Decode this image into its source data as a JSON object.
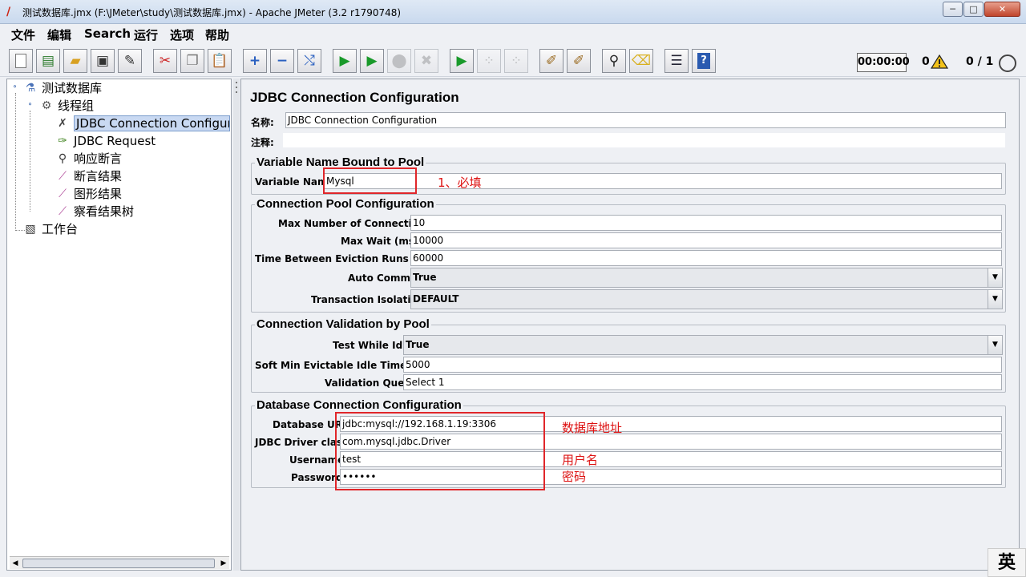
{
  "window": {
    "title": "测试数据库.jmx (F:\\JMeter\\study\\测试数据库.jmx) - Apache JMeter (3.2 r1790748)",
    "minimize": "─",
    "maximize": "□",
    "close": "✕"
  },
  "menu": [
    "文件",
    "编辑",
    "Search",
    "运行",
    "选项",
    "帮助"
  ],
  "toolbar": {
    "timer": "00:00:00",
    "error_count": "0",
    "thread_status": "0 / 1",
    "icons": [
      "new-icon",
      "templates-icon",
      "open-icon",
      "save-icon",
      "save-as-icon",
      "cut-icon",
      "copy-icon",
      "paste-icon",
      "expand-icon",
      "collapse-icon",
      "toggle-icon",
      "start-icon",
      "start-no-pause-icon",
      "stop-icon",
      "shutdown-icon",
      "remote-start-icon",
      "remote-stop-icon",
      "remote-shutdown-icon",
      "clear-icon",
      "clear-all-icon",
      "search-icon",
      "reset-search-icon",
      "function-helper-icon",
      "help-icon"
    ]
  },
  "tree": {
    "items": [
      {
        "label": "测试数据库",
        "icon": "test-plan-icon"
      },
      {
        "label": "线程组",
        "icon": "thread-group-icon"
      },
      {
        "label": "JDBC Connection Configuratio",
        "icon": "config-tool-icon"
      },
      {
        "label": "JDBC Request",
        "icon": "sampler-icon"
      },
      {
        "label": "响应断言",
        "icon": "assertion-icon"
      },
      {
        "label": "断言结果",
        "icon": "listener-icon"
      },
      {
        "label": "图形结果",
        "icon": "listener-icon"
      },
      {
        "label": "察看结果树",
        "icon": "listener-icon"
      },
      {
        "label": "工作台",
        "icon": "workbench-icon"
      }
    ]
  },
  "form": {
    "title": "JDBC Connection Configuration",
    "name_label": "名称:",
    "name_value": "JDBC Connection Configuration",
    "comment_label": "注释:",
    "comment_value": "",
    "pool_var": {
      "title": "Variable Name Bound to Pool",
      "label": "Variable Name:",
      "value": "Mysql"
    },
    "pool_config": {
      "title": "Connection Pool Configuration",
      "max_conn_label": "Max Number of Connections:",
      "max_conn_value": "10",
      "max_wait_label": "Max Wait (ms):",
      "max_wait_value": "10000",
      "eviction_label": "Time Between Eviction Runs (ms):",
      "eviction_value": "60000",
      "auto_commit_label": "Auto Commit:",
      "auto_commit_value": "True",
      "isolation_label": "Transaction Isolation:",
      "isolation_value": "DEFAULT"
    },
    "validation": {
      "title": "Connection Validation by Pool",
      "test_idle_label": "Test While Idle:",
      "test_idle_value": "True",
      "soft_min_label": "Soft Min Evictable Idle Time(ms):",
      "soft_min_value": "5000",
      "query_label": "Validation Query:",
      "query_value": "Select 1"
    },
    "db": {
      "title": "Database Connection Configuration",
      "url_label": "Database URL:",
      "url_value": "jdbc:mysql://192.168.1.19:3306",
      "driver_label": "JDBC Driver class:",
      "driver_value": "com.mysql.jdbc.Driver",
      "user_label": "Username:",
      "user_value": "test",
      "pass_label": "Password:",
      "pass_value": "••••••"
    }
  },
  "annotations": {
    "required": "1、必填",
    "db_address": "数据库地址",
    "username": "用户名",
    "password": "密码",
    "color": "#e0262a"
  },
  "ime": "英"
}
